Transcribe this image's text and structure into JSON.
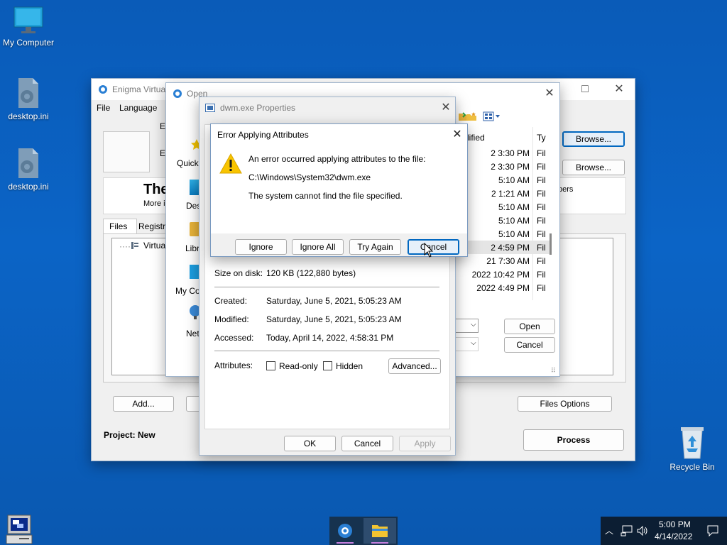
{
  "desktop": {
    "icons": [
      {
        "label": "My Computer",
        "icon": "monitor-icon"
      },
      {
        "label": "desktop.ini",
        "icon": "settings-file-icon"
      },
      {
        "label": "desktop.ini",
        "icon": "settings-file-icon"
      },
      {
        "label": "Recycle Bin",
        "icon": "recycle-bin-icon"
      }
    ]
  },
  "enigma": {
    "title": "Enigma Virtua",
    "menu": [
      "File",
      "Language"
    ],
    "field_labels": [
      "Er",
      "Er"
    ],
    "browse_label": "Browse...",
    "banner_title": "The",
    "banner_sub": "More i",
    "banner_right": "pers",
    "tabs": [
      "Files",
      "Registry"
    ],
    "tree_root": "Virtual",
    "add_label": "Add...",
    "files_options_label": "Files Options",
    "project_label": "Project: New",
    "process_label": "Process"
  },
  "open_dialog": {
    "title": "Open",
    "nav_items": [
      "Quick",
      "Desk",
      "Libr",
      "My Co",
      "Netv"
    ],
    "col_modified": "dified",
    "col_type": "Ty",
    "rows": [
      {
        "modified": "2 3:30 PM",
        "type": "Fil"
      },
      {
        "modified": "2 3:30 PM",
        "type": "Fil"
      },
      {
        "modified": "5:10 AM",
        "type": "Fil"
      },
      {
        "modified": "2 1:21 AM",
        "type": "Fil"
      },
      {
        "modified": "5:10 AM",
        "type": "Fil"
      },
      {
        "modified": "5:10 AM",
        "type": "Fil"
      },
      {
        "modified": "5:10 AM",
        "type": "Fil"
      },
      {
        "modified": "2 4:59 PM",
        "type": "Fil"
      },
      {
        "modified": "21 7:30 AM",
        "type": "Fil"
      },
      {
        "modified": "2022 10:42 PM",
        "type": "Fil"
      },
      {
        "modified": "2022 4:49 PM",
        "type": "Fil"
      }
    ],
    "open_label": "Open",
    "cancel_label": "Cancel"
  },
  "properties": {
    "title": "dwm.exe Properties",
    "size_on_disk_label": "Size on disk:",
    "size_on_disk": "120 KB (122,880 bytes)",
    "created_label": "Created:",
    "created": "Saturday, June 5, 2021, 5:05:23 AM",
    "modified_label": "Modified:",
    "modified": "Saturday, June 5, 2021, 5:05:23 AM",
    "accessed_label": "Accessed:",
    "accessed": "Today, April 14, 2022, 4:58:31 PM",
    "attributes_label": "Attributes:",
    "readonly_label": "Read-only",
    "hidden_label": "Hidden",
    "advanced_label": "Advanced...",
    "ok_label": "OK",
    "cancel_label": "Cancel",
    "apply_label": "Apply"
  },
  "error_dialog": {
    "title": "Error Applying Attributes",
    "message": "An error occurred applying attributes to the file:",
    "path": "C:\\Windows\\System32\\dwm.exe",
    "detail": "The system cannot find the file specified.",
    "buttons": [
      "Ignore",
      "Ignore All",
      "Try Again",
      "Cancel"
    ]
  },
  "taskbar": {
    "time": "5:00 PM",
    "date": "4/14/2022"
  },
  "colors": {
    "desktop": "#0b64c6",
    "accent": "#0067c0",
    "tray": "#0c1e33"
  }
}
